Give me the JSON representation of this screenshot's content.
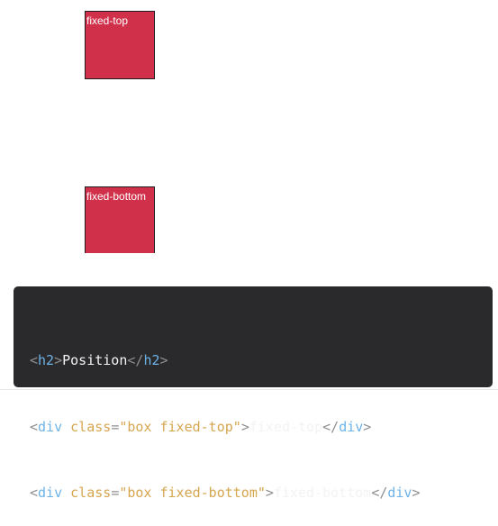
{
  "boxes": {
    "top_label": "fixed-top",
    "bottom_label": "fixed-bottom"
  },
  "code": {
    "line1": {
      "open_lt": "<",
      "open_tag": "h2",
      "open_gt": ">",
      "text": "Position",
      "close_lt": "</",
      "close_tag": "h2",
      "close_gt": ">"
    },
    "line2": {
      "open_lt": "<",
      "open_tag": "div",
      "attr": "class",
      "eq": "=",
      "value": "\"box fixed-top\"",
      "open_gt": ">",
      "text": "fixed-top",
      "close_lt": "</",
      "close_tag": "div",
      "close_gt": ">"
    },
    "line3": {
      "open_lt": "<",
      "open_tag": "div",
      "attr": "class",
      "eq": "=",
      "value": "\"box fixed-bottom\"",
      "open_gt": ">",
      "text": "fixed-bottom",
      "close_lt": "</",
      "close_tag": "div",
      "close_gt": ">"
    }
  },
  "colors": {
    "box": "#d1304a",
    "code_bg": "#2a2a2c",
    "tag": "#6db3e8",
    "attr": "#d6a64f"
  }
}
